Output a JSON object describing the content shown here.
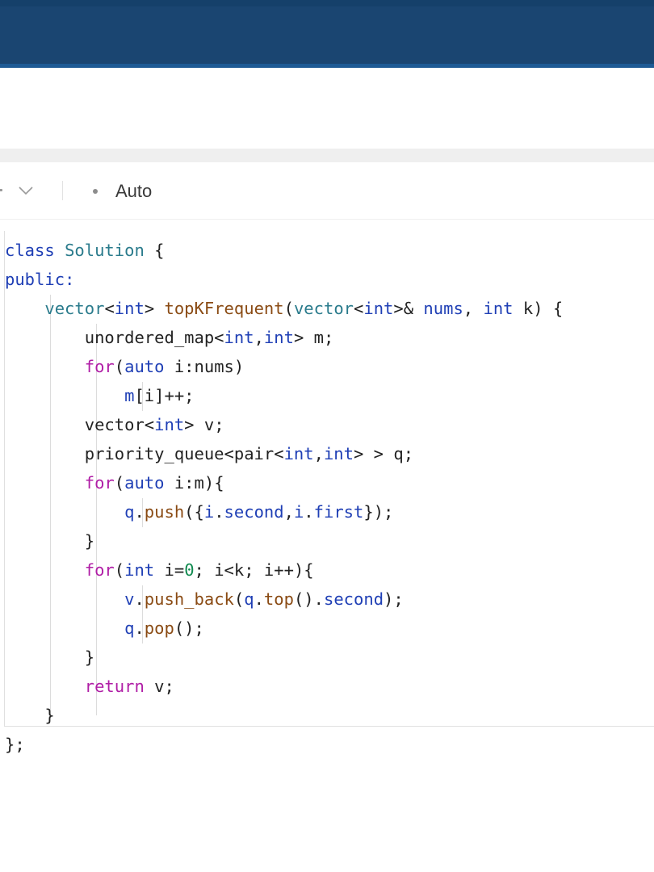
{
  "toolbar": {
    "language_mode": "Auto"
  },
  "code": {
    "lines": [
      [
        {
          "t": "class ",
          "c": "kw-blue"
        },
        {
          "t": "Solution ",
          "c": "kw-teal"
        },
        {
          "t": "{",
          "c": "id-dark"
        }
      ],
      [
        {
          "t": "public:",
          "c": "kw-blue"
        }
      ],
      [
        {
          "t": "    ",
          "c": "id-dark"
        },
        {
          "t": "vector",
          "c": "kw-teal"
        },
        {
          "t": "<",
          "c": "id-dark"
        },
        {
          "t": "int",
          "c": "kw-blue"
        },
        {
          "t": "> ",
          "c": "id-dark"
        },
        {
          "t": "topKFrequent",
          "c": "fn-brown"
        },
        {
          "t": "(",
          "c": "id-dark"
        },
        {
          "t": "vector",
          "c": "kw-teal"
        },
        {
          "t": "<",
          "c": "id-dark"
        },
        {
          "t": "int",
          "c": "kw-blue"
        },
        {
          "t": ">& ",
          "c": "id-dark"
        },
        {
          "t": "nums",
          "c": "kw-blue"
        },
        {
          "t": ", ",
          "c": "id-dark"
        },
        {
          "t": "int",
          "c": "kw-blue"
        },
        {
          "t": " k) {",
          "c": "id-dark"
        }
      ],
      [
        {
          "t": "        unordered_map<",
          "c": "id-dark"
        },
        {
          "t": "int",
          "c": "kw-blue"
        },
        {
          "t": ",",
          "c": "id-dark"
        },
        {
          "t": "int",
          "c": "kw-blue"
        },
        {
          "t": "> m;",
          "c": "id-dark"
        }
      ],
      [
        {
          "t": "        ",
          "c": "id-dark"
        },
        {
          "t": "for",
          "c": "kw-purple"
        },
        {
          "t": "(",
          "c": "id-dark"
        },
        {
          "t": "auto",
          "c": "kw-blue"
        },
        {
          "t": " i:nums)",
          "c": "id-dark"
        }
      ],
      [
        {
          "t": "            ",
          "c": "id-dark"
        },
        {
          "t": "m",
          "c": "member"
        },
        {
          "t": "[i]++;",
          "c": "id-dark"
        }
      ],
      [
        {
          "t": "        vector<",
          "c": "id-dark"
        },
        {
          "t": "int",
          "c": "kw-blue"
        },
        {
          "t": "> v;",
          "c": "id-dark"
        }
      ],
      [
        {
          "t": "        priority_queue<pair<",
          "c": "id-dark"
        },
        {
          "t": "int",
          "c": "kw-blue"
        },
        {
          "t": ",",
          "c": "id-dark"
        },
        {
          "t": "int",
          "c": "kw-blue"
        },
        {
          "t": "> > q;",
          "c": "id-dark"
        }
      ],
      [
        {
          "t": "        ",
          "c": "id-dark"
        },
        {
          "t": "for",
          "c": "kw-purple"
        },
        {
          "t": "(",
          "c": "id-dark"
        },
        {
          "t": "auto",
          "c": "kw-blue"
        },
        {
          "t": " i:m){",
          "c": "id-dark"
        }
      ],
      [
        {
          "t": "            ",
          "c": "id-dark"
        },
        {
          "t": "q",
          "c": "member"
        },
        {
          "t": ".",
          "c": "id-dark"
        },
        {
          "t": "push",
          "c": "fn-brown"
        },
        {
          "t": "({",
          "c": "id-dark"
        },
        {
          "t": "i",
          "c": "member"
        },
        {
          "t": ".",
          "c": "id-dark"
        },
        {
          "t": "second",
          "c": "member"
        },
        {
          "t": ",",
          "c": "id-dark"
        },
        {
          "t": "i",
          "c": "member"
        },
        {
          "t": ".",
          "c": "id-dark"
        },
        {
          "t": "first",
          "c": "member"
        },
        {
          "t": "});",
          "c": "id-dark"
        }
      ],
      [
        {
          "t": "        }",
          "c": "id-dark"
        }
      ],
      [
        {
          "t": "        ",
          "c": "id-dark"
        },
        {
          "t": "for",
          "c": "kw-purple"
        },
        {
          "t": "(",
          "c": "id-dark"
        },
        {
          "t": "int",
          "c": "kw-blue"
        },
        {
          "t": " i=",
          "c": "id-dark"
        },
        {
          "t": "0",
          "c": "num-green"
        },
        {
          "t": "; i<k; i++){",
          "c": "id-dark"
        }
      ],
      [
        {
          "t": "            ",
          "c": "id-dark"
        },
        {
          "t": "v",
          "c": "member"
        },
        {
          "t": ".",
          "c": "id-dark"
        },
        {
          "t": "push_back",
          "c": "fn-brown"
        },
        {
          "t": "(",
          "c": "id-dark"
        },
        {
          "t": "q",
          "c": "member"
        },
        {
          "t": ".",
          "c": "id-dark"
        },
        {
          "t": "top",
          "c": "fn-brown"
        },
        {
          "t": "().",
          "c": "id-dark"
        },
        {
          "t": "second",
          "c": "member"
        },
        {
          "t": ");",
          "c": "id-dark"
        }
      ],
      [
        {
          "t": "            ",
          "c": "id-dark"
        },
        {
          "t": "q",
          "c": "member"
        },
        {
          "t": ".",
          "c": "id-dark"
        },
        {
          "t": "pop",
          "c": "fn-brown"
        },
        {
          "t": "();",
          "c": "id-dark"
        }
      ],
      [
        {
          "t": "        }",
          "c": "id-dark"
        }
      ],
      [
        {
          "t": "        ",
          "c": "id-dark"
        },
        {
          "t": "return",
          "c": "kw-purple"
        },
        {
          "t": " v;",
          "c": "id-dark"
        }
      ],
      [
        {
          "t": "    }",
          "c": "id-dark"
        }
      ],
      [
        {
          "t": "};",
          "c": "id-dark"
        }
      ]
    ]
  },
  "colors": {
    "header_bar": "#1a4571",
    "keyword_blue": "#1f3fb5",
    "keyword_purple": "#b01ea6",
    "type_teal": "#2a7b8c",
    "function_brown": "#8a4b14",
    "number_green": "#0f8a4f"
  }
}
